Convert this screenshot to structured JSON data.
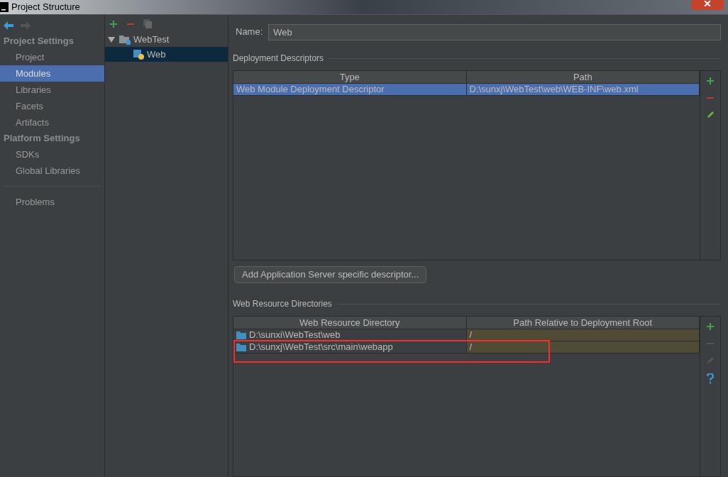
{
  "window": {
    "title": "Project Structure"
  },
  "sidebar": {
    "sections": [
      {
        "heading": "Project Settings",
        "items": [
          {
            "label": "Project",
            "selected": false
          },
          {
            "label": "Modules",
            "selected": true
          },
          {
            "label": "Libraries",
            "selected": false
          },
          {
            "label": "Facets",
            "selected": false
          },
          {
            "label": "Artifacts",
            "selected": false
          }
        ]
      },
      {
        "heading": "Platform Settings",
        "items": [
          {
            "label": "SDKs",
            "selected": false
          },
          {
            "label": "Global Libraries",
            "selected": false
          }
        ]
      }
    ],
    "footer_items": [
      {
        "label": "Problems",
        "selected": false
      }
    ]
  },
  "tree": {
    "items": [
      {
        "label": "WebTest",
        "kind": "folder",
        "expanded": true,
        "selected": false,
        "children": [
          {
            "label": "Web",
            "kind": "module",
            "selected": true
          }
        ]
      }
    ]
  },
  "name_field": {
    "label": "Name:",
    "value": "Web"
  },
  "deployment_descriptors": {
    "title": "Deployment Descriptors",
    "columns": [
      "Type",
      "Path"
    ],
    "rows": [
      {
        "cells": [
          "Web Module Deployment Descriptor",
          "D:\\sunxj\\WebTest\\web\\WEB-INF\\web.xml"
        ],
        "selected": true
      }
    ],
    "add_button": "Add Application Server specific descriptor..."
  },
  "web_resource_directories": {
    "title": "Web Resource Directories",
    "columns": [
      "Web Resource Directory",
      "Path Relative to Deployment Root"
    ],
    "rows": [
      {
        "cells": [
          "D:\\sunxi\\WebTest\\web",
          "/"
        ],
        "selected": false,
        "highlighted": false
      },
      {
        "cells": [
          "D:\\sunxj\\WebTest\\src\\main\\webapp",
          "/"
        ],
        "selected": false,
        "highlighted": true
      }
    ]
  }
}
